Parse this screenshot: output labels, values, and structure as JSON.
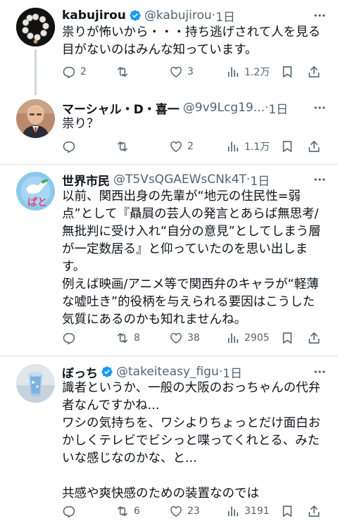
{
  "tweets": [
    {
      "name": "kabujirou",
      "verified": true,
      "handle": "@kabujirou",
      "sep": "·",
      "time": "1日",
      "text": "祟りが怖いから・・・持ち逃げされて人を見る\n目がないのはみんな知っています。",
      "replies": "2",
      "retweets": "",
      "likes": "3",
      "views": "1.2万"
    },
    {
      "name": "マーシャル・D・喜一",
      "verified": false,
      "handle": "@9v9Lcg19...",
      "sep": "·",
      "time": "1日",
      "text": "祟り？",
      "replies": "",
      "retweets": "",
      "likes": "2",
      "views": "1.1万"
    },
    {
      "name": "世界市民",
      "verified": false,
      "handle": "@T5VsQGAEWsCNk4T",
      "sep": "·",
      "time": "1日",
      "text": "以前、関西出身の先輩が“地元の住民性=弱\n点”として『贔屓の芸人の発言とあらば無思考/\n無批判に受け入れ“自分の意見”としてしまう層\nが一定数居る』と仰っていたのを思い出しま\nす。\n例えば映画/アニメ等で関西弁のキャラが“軽薄\nな嘘吐き”的役柄を与えられる要因はこうした\n気質にあるのかも知れませんね。",
      "replies": "",
      "retweets": "8",
      "likes": "38",
      "views": "2905"
    },
    {
      "name": "ぼっち",
      "verified": true,
      "handle": "@takeiteasy_figu",
      "sep": "·",
      "time": "1日",
      "text": "識者というか、一般の大阪のおっちゃんの代弁\n者なんですかね...\nワシの気持ちを、ワシよりちょっとだけ面白お\nかしくテレビでビシっと喋ってくれとる、みた\nいな感じなのかな、と...\n\n共感や爽快感のための装置なのでは",
      "replies": "",
      "retweets": "6",
      "likes": "23",
      "views": "3191"
    }
  ],
  "icons": {
    "reply": "reply-icon",
    "retweet": "retweet-icon",
    "like": "like-icon",
    "views": "views-icon",
    "bookmark": "bookmark-icon",
    "share": "share-icon",
    "more": "more-icon",
    "verified": "verified-icon"
  },
  "colors": {
    "text": "#0f1419",
    "secondary": "#536471",
    "verified": "#1d9bf0",
    "divider": "#dfe3e7"
  }
}
